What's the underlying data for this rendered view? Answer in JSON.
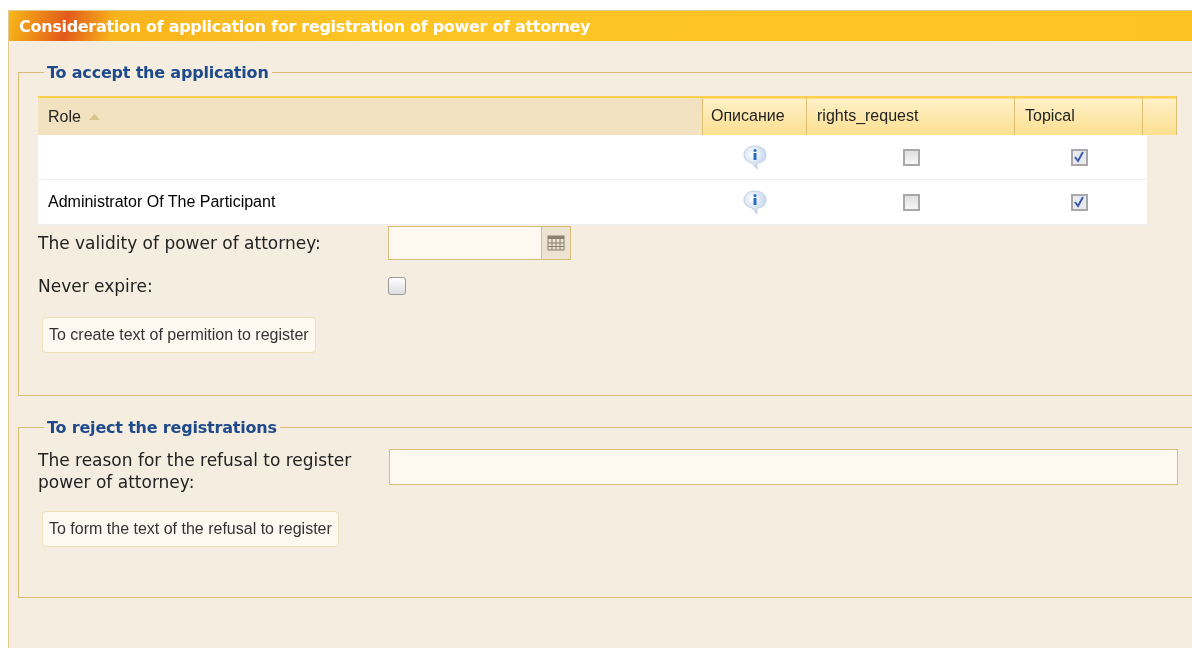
{
  "panel": {
    "title": "Consideration of application for registration of power of attorney"
  },
  "accept": {
    "legend": "To accept the application",
    "table": {
      "columns": [
        {
          "label": "Role",
          "sorted": true
        },
        {
          "label": "Описание",
          "sorted": false
        },
        {
          "label": "rights_request",
          "sorted": false
        },
        {
          "label": "Topical",
          "sorted": false
        }
      ],
      "rows": [
        {
          "role": "",
          "rights_request": false,
          "topical": true
        },
        {
          "role": "Administrator Of The Participant",
          "rights_request": false,
          "topical": true
        }
      ]
    },
    "validity_label": "The validity of power of attorney:",
    "never_expire": {
      "label": "Never expire:",
      "checked": false
    },
    "button": "To create text of permition to register"
  },
  "reject": {
    "legend": "To reject the registrations",
    "reason_label": "The reason for the refusal to register power of attorney:",
    "button": "To form the text of the refusal to register"
  }
}
